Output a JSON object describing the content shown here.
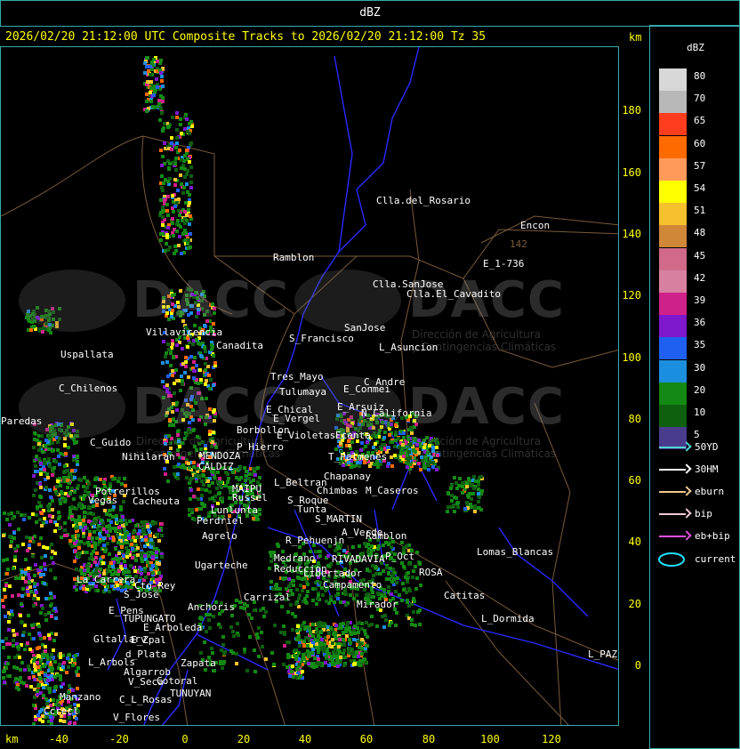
{
  "top_title": "dBZ",
  "header": "2026/02/20 21:12:00 UTC Composite Tracks to 2026/02/20 21:12:00 Tz 35",
  "km_label": "km",
  "legend": {
    "title": "dBZ",
    "scale": [
      {
        "label": "80",
        "color": "#d8d8d8"
      },
      {
        "label": "70",
        "color": "#b8b8b8"
      },
      {
        "label": "65",
        "color": "#ff3c1e"
      },
      {
        "label": "60",
        "color": "#ff6a00"
      },
      {
        "label": "57",
        "color": "#ff9a5a"
      },
      {
        "label": "54",
        "color": "#ffff00"
      },
      {
        "label": "51",
        "color": "#f5c22e"
      },
      {
        "label": "48",
        "color": "#d08838"
      },
      {
        "label": "45",
        "color": "#d06a88"
      },
      {
        "label": "42",
        "color": "#d880a0"
      },
      {
        "label": "39",
        "color": "#d0208a"
      },
      {
        "label": "36",
        "color": "#7e18cc"
      },
      {
        "label": "35",
        "color": "#2060f0"
      },
      {
        "label": "30",
        "color": "#1c8ee0"
      },
      {
        "label": "20",
        "color": "#138a13"
      },
      {
        "label": "10",
        "color": "#0e5f0e"
      },
      {
        "label": "5",
        "color": "#4a3c8c"
      }
    ],
    "tracks": [
      {
        "label": "50YD",
        "color": "#4fd6d6"
      },
      {
        "label": "30HM",
        "color": "#ffffff"
      },
      {
        "label": "eburn",
        "color": "#f0c890"
      },
      {
        "label": "bip",
        "color": "#f2c8d8"
      },
      {
        "label": "eb+bip",
        "color": "#e050e0"
      }
    ],
    "current_label": "current",
    "current_color": "#20e0ff"
  },
  "y_ticks": [
    "180",
    "160",
    "140",
    "120",
    "100",
    "80",
    "60",
    "40",
    "20",
    "0"
  ],
  "x_ticks": [
    "-40",
    "-20",
    "0",
    "20",
    "40",
    "60",
    "80",
    "100",
    "120"
  ],
  "places": [
    "Clla.del_Rosario",
    "Encon",
    "142",
    "E_1-736",
    "Ramblon",
    "Clla.SanJose",
    "Clla.El_Cavadito",
    "Villavicencia",
    "Canadita",
    "S_Francisco",
    "SanJose",
    "L_Asuncion",
    "Uspallata",
    "Tres_Mayo",
    "C_Andre",
    "Tulumaya",
    "E_Conmei",
    "C_Chilenos",
    "E_Chical",
    "E_Vergel",
    "E_Arsuiz",
    "N_California",
    "Paredas",
    "Borbollon",
    "E_Violetas",
    "Ecenta",
    "P_Hierro",
    "C_Guido",
    "Nihilaran",
    "MENDOZA",
    "T_Palmenes",
    "CALDIZ",
    "Chapanay",
    "L_Beltran",
    "Chimbas",
    "M_Caseros",
    "MAIPU",
    "Potrerillos",
    "Russel",
    "Vegas",
    "Cacheuta",
    "Lunlunta",
    "S_Roque",
    "Tunta",
    "S_MARTIN",
    "Perdriel",
    "A_Verde",
    "Ramblon",
    "Agrelo",
    "R_Pehuenjn",
    "Lomas_Blancas",
    "Medrano",
    "Reduccion",
    "Ugarteche",
    "P_Oct",
    "ROSA",
    "RIVADAVIA",
    "La_Carrera",
    "Cto_Rey",
    "S_Jose",
    "Carrizal",
    "Libertador",
    "Campamento",
    "Catitas",
    "E_Pens",
    "Anchoris",
    "TUPUNGATO",
    "Mirador",
    "L_Dormida",
    "E_Arboleda",
    "E_Zpal",
    "Gltallarv",
    "d_Plata",
    "Zapata",
    "L_PAZ",
    "L_Arbols",
    "Algarrob",
    "V_Seca",
    "Cotoral",
    "TUNUYAN",
    "Manzano",
    "C_L_Rosas",
    "V_Flores",
    "Ccrecl"
  ],
  "watermark": {
    "brand": "DACC",
    "subtitle_line1": "Dirección de Agricultura",
    "subtitle_line2": "y Contingencias Climáticas"
  }
}
